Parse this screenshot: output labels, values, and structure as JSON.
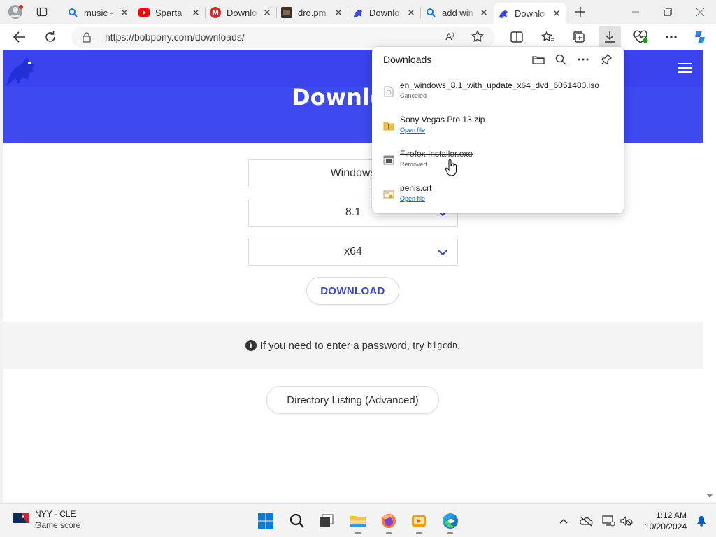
{
  "tabs": [
    {
      "title": "music -",
      "icon": "search-icon"
    },
    {
      "title": "Sparta",
      "icon": "youtube-icon"
    },
    {
      "title": "Downlo",
      "icon": "mega-icon"
    },
    {
      "title": "dro.pm",
      "icon": "film-thumbnail-icon"
    },
    {
      "title": "Downlo",
      "icon": "bobpony-icon"
    },
    {
      "title": "add win",
      "icon": "search-icon"
    },
    {
      "title": "Downlo",
      "icon": "bobpony-icon",
      "active": true
    }
  ],
  "address": {
    "url": "https://bobpony.com/downloads/",
    "read_aloud": "A⁾"
  },
  "page": {
    "hero_title": "Downlo",
    "os": "Windows",
    "version": "8.1",
    "arch": "x64",
    "download_label": "DOWNLOAD",
    "notice_text": "If you need to enter a password, try",
    "notice_code": "bigcdn",
    "notice_end": ".",
    "directory_label": "Directory Listing (Advanced)"
  },
  "downloads": {
    "title": "Downloads",
    "items": [
      {
        "name": "en_windows_8.1_with_update_x64_dvd_6051480.iso",
        "status": "Canceled",
        "type": "iso"
      },
      {
        "name": "Sony Vegas Pro 13.zip",
        "status": "Open file",
        "type": "zip"
      },
      {
        "name": "Firefox Installer.exe",
        "status": "Removed",
        "type": "exe"
      },
      {
        "name": "penis.crt",
        "status": "Open file",
        "type": "crt"
      }
    ]
  },
  "taskbar": {
    "weather_title": "NYY - CLE",
    "weather_sub": "Game score",
    "time": "1:12 AM",
    "date": "10/20/2024"
  },
  "colors": {
    "hero": "#3e49f0",
    "accent": "#3b44c9",
    "link": "#0f6cbd"
  }
}
